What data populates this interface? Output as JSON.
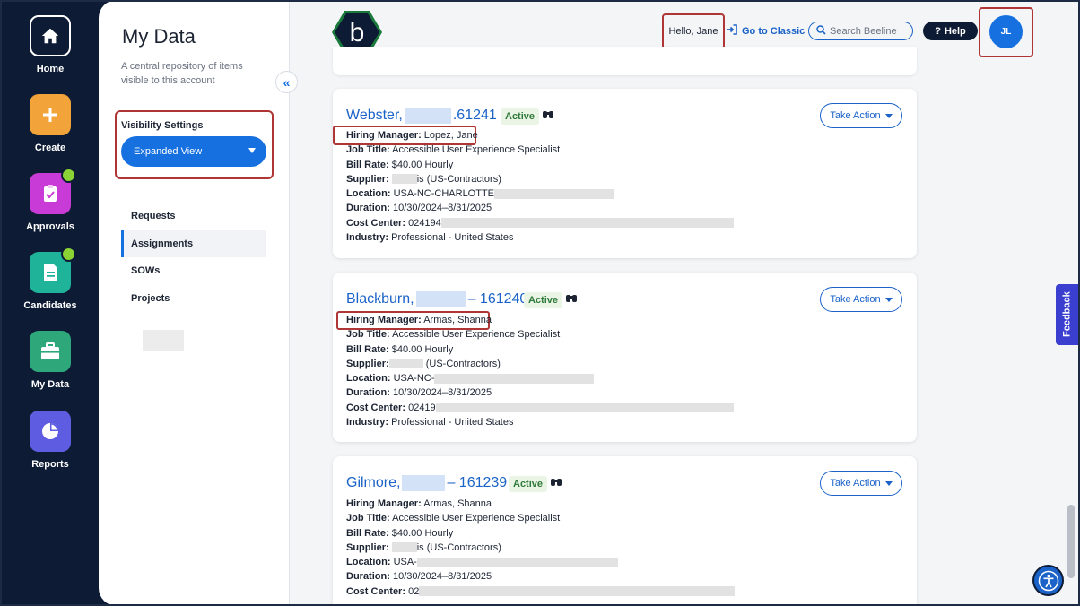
{
  "rail": {
    "items": [
      {
        "label": "Home",
        "icon": "home-icon",
        "color": "#0d1b34"
      },
      {
        "label": "Create",
        "icon": "plus-icon",
        "color": "#f2a33a"
      },
      {
        "label": "Approvals",
        "icon": "clipboard-check-icon",
        "color": "#c93bd6"
      },
      {
        "label": "Candidates",
        "icon": "document-icon",
        "color": "#1fb39a"
      },
      {
        "label": "My Data",
        "icon": "briefcase-icon",
        "color": "#2ea87b"
      },
      {
        "label": "Reports",
        "icon": "pie-chart-icon",
        "color": "#5e5ce0"
      }
    ]
  },
  "panel": {
    "title": "My Data",
    "description": "A central repository of items visible to this account",
    "visibility_label": "Visibility Settings",
    "visibility_value": "Expanded View",
    "nav": [
      {
        "label": "Requests",
        "active": false
      },
      {
        "label": "Assignments",
        "active": true
      },
      {
        "label": "SOWs",
        "active": false
      },
      {
        "label": "Projects",
        "active": false
      }
    ]
  },
  "header": {
    "logo_letter": "b",
    "greeting": "Hello, Jane",
    "classic_link": "Go to Classic",
    "search_placeholder": "Search Beeline",
    "help_label": "Help",
    "help_mark": "?",
    "avatar_initials": "JL"
  },
  "labels": {
    "hiring_manager": "Hiring Manager:",
    "job_title": "Job Title:",
    "bill_rate": "Bill Rate:",
    "supplier": "Supplier:",
    "location": "Location:",
    "duration": "Duration:",
    "cost_center": "Cost Center:",
    "industry": "Industry:",
    "take_action": "Take Action",
    "collapse": "«"
  },
  "cards": [
    {
      "name_prefix": "Webster,",
      "name_suffix": ".61241",
      "status": "Active",
      "hiring_manager": "Lopez, Jane",
      "job_title": "Accessible User Experience Specialist",
      "bill_rate": "$40.00 Hourly",
      "supplier": "is (US-Contractors)",
      "location": "USA-NC-CHARLOTTE",
      "duration": "10/30/2024–8/31/2025",
      "cost_center": "024194",
      "industry": "Professional - United States"
    },
    {
      "name_prefix": "Blackburn,",
      "name_suffix": "– 161240",
      "status": "Active",
      "hiring_manager": "Armas, Shanna",
      "job_title": "Accessible User Experience Specialist",
      "bill_rate": "$40.00 Hourly",
      "supplier": "(US-Contractors)",
      "location": "USA-NC-",
      "duration": "10/30/2024–8/31/2025",
      "cost_center": "02419",
      "industry": "Professional - United States"
    },
    {
      "name_prefix": "Gilmore,",
      "name_suffix": "– 161239",
      "status": "Active",
      "hiring_manager": "Armas, Shanna",
      "job_title": "Accessible User Experience Specialist",
      "bill_rate": "$40.00 Hourly",
      "supplier": "is (US-Contractors)",
      "location": "USA-",
      "duration": "10/30/2024–8/31/2025",
      "cost_center": "02",
      "industry": ""
    }
  ],
  "feedback_label": "Feedback",
  "colors": {
    "brand": "#1670e0",
    "rail_bg": "#0d1b34",
    "highlight_border": "#b03636",
    "status_green": "#2f7a3a"
  }
}
